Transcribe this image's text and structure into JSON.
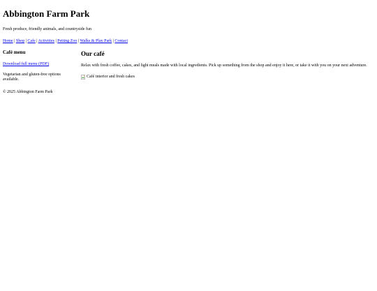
{
  "site": {
    "title": "Abbington Farm Park",
    "tagline": "Fresh produce, friendly animals, and countryside fun"
  },
  "nav": {
    "items": [
      {
        "label": "Home"
      },
      {
        "label": "Shop"
      },
      {
        "label": "Cafe"
      },
      {
        "label": "Activities"
      },
      {
        "label": "Petting Zoo"
      },
      {
        "label": "Walks & Play Park"
      },
      {
        "label": "Contact"
      }
    ],
    "separator": "|"
  },
  "sidebar": {
    "heading": "Café menu",
    "download_link": "Download full menu (PDF)",
    "note": "Vegetarian and gluten-free options available."
  },
  "main": {
    "heading": "Our café",
    "intro": "Relax with fresh coffee, cakes, and light meals made with local ingredients. Pick up something from the shop and enjoy it here, or take it with you on your next adventure.",
    "image_alt": "Café interior and fresh cakes",
    "image_icon": "broken-image-icon"
  },
  "footer": {
    "copyright": "© 2025 Abbington Farm Park"
  },
  "colors": {
    "link": "#0000ee",
    "text": "#000000",
    "background": "#ffffff"
  }
}
